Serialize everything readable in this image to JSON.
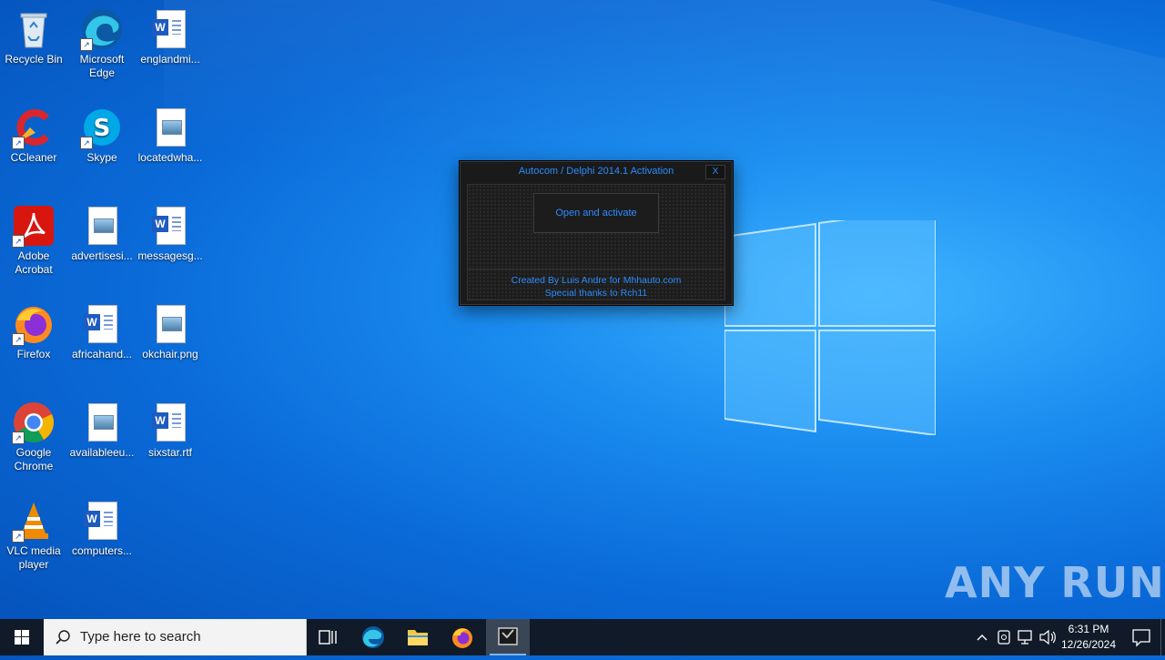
{
  "desktop": {
    "icons": [
      {
        "label": "Recycle Bin",
        "icon": "recycle-bin-icon"
      },
      {
        "label": "Microsoft Edge",
        "icon": "edge-icon"
      },
      {
        "label": "englandmi...",
        "icon": "word-doc-icon"
      },
      {
        "label": "CCleaner",
        "icon": "ccleaner-icon"
      },
      {
        "label": "Skype",
        "icon": "skype-icon"
      },
      {
        "label": "locatedwha...",
        "icon": "image-file-icon"
      },
      {
        "label": "Adobe Acrobat",
        "icon": "acrobat-icon"
      },
      {
        "label": "advertisesi...",
        "icon": "image-file-icon"
      },
      {
        "label": "messagesg...",
        "icon": "word-doc-icon"
      },
      {
        "label": "Firefox",
        "icon": "firefox-icon"
      },
      {
        "label": "africahand...",
        "icon": "word-doc-icon"
      },
      {
        "label": "okchair.png",
        "icon": "image-file-icon"
      },
      {
        "label": "Google Chrome",
        "icon": "chrome-icon"
      },
      {
        "label": "availableeu...",
        "icon": "image-file-icon"
      },
      {
        "label": "sixstar.rtf",
        "icon": "word-doc-icon"
      },
      {
        "label": "VLC media player",
        "icon": "vlc-icon"
      },
      {
        "label": "computers...",
        "icon": "word-doc-icon"
      }
    ]
  },
  "app_window": {
    "title": "Autocom / Delphi 2014.1 Activation",
    "close_label": "X",
    "button_label": "Open and activate",
    "credit_line1": "Created By Luis Andre for Mhhauto.com",
    "credit_line2": "Special thanks to Rch11",
    "accent_color": "#2a8cff"
  },
  "watermark": {
    "text": "ANY RUN"
  },
  "taskbar": {
    "search_placeholder": "Type here to search",
    "pinned": [
      {
        "name": "task-view",
        "icon": "task-view-icon"
      },
      {
        "name": "edge",
        "icon": "edge-icon"
      },
      {
        "name": "file-explorer",
        "icon": "folder-icon"
      },
      {
        "name": "firefox",
        "icon": "firefox-icon"
      },
      {
        "name": "activation-app",
        "icon": "app-window-icon",
        "active": true
      }
    ],
    "clock_time": "6:31 PM",
    "clock_date": "12/26/2024"
  }
}
